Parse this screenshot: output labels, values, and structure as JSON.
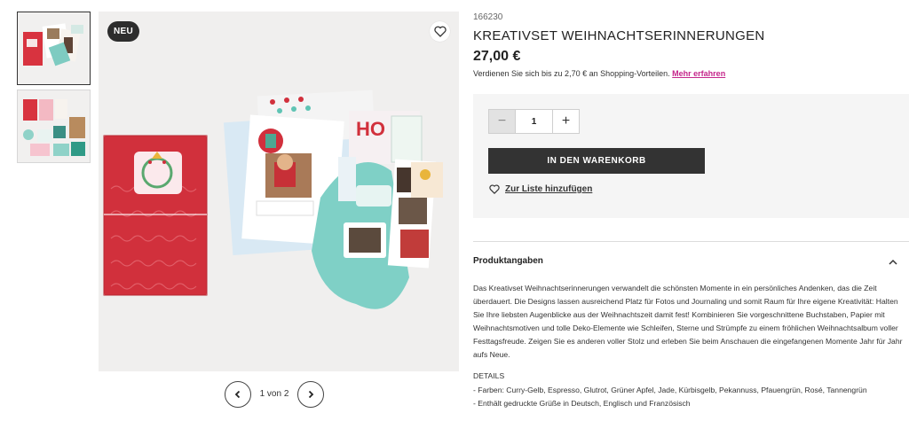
{
  "gallery": {
    "badge": "NEU",
    "pager_text": "1 von 2"
  },
  "product": {
    "sku": "166230",
    "title": "KREATIVSET WEIHNACHTSERINNERUNGEN",
    "price": "27,00 €",
    "earn_text": "Verdienen Sie sich bis zu 2,70 € an Shopping-Vorteilen.",
    "earn_link": "Mehr erfahren"
  },
  "buybox": {
    "qty_minus": "−",
    "qty_value": "1",
    "qty_plus": "+",
    "add_to_cart": "IN DEN WARENKORB",
    "add_to_list": "Zur Liste hinzufügen"
  },
  "details": {
    "accordion_title": "Produktangaben",
    "description": "Das Kreativset Weihnachtserinnerungen verwandelt die schönsten Momente in ein persönliches Andenken, das die Zeit überdauert. Die Designs lassen ausreichend Platz für Fotos und Journaling und somit Raum für Ihre eigene Kreativität: Halten Sie Ihre liebsten Augenblicke aus der Weihnachtszeit damit fest! Kombinieren Sie vorgeschnittene Buchstaben, Papier mit Weihnachtsmotiven und tolle Deko-Elemente wie Schleifen, Sterne und Strümpfe zu einem fröhlichen Weihnachtsalbum voller Festtagsfreude. Zeigen Sie es anderen voller Stolz und erleben Sie beim Anschauen die eingefangenen Momente Jahr für Jahr aufs Neue.",
    "details_heading": "DETAILS",
    "details_items": [
      "- Farben: Curry-Gelb, Espresso, Glutrot, Grüner Apfel, Jade, Kürbisgelb, Pekannuss, Pfauengrün, Rosé, Tannengrün",
      "- Enthält gedruckte Grüße in Deutsch, Englisch und Französisch"
    ]
  },
  "colors": {
    "accent_link": "#c5268b",
    "button_dark": "#333333",
    "buybox_bg": "#f5f5f5"
  }
}
